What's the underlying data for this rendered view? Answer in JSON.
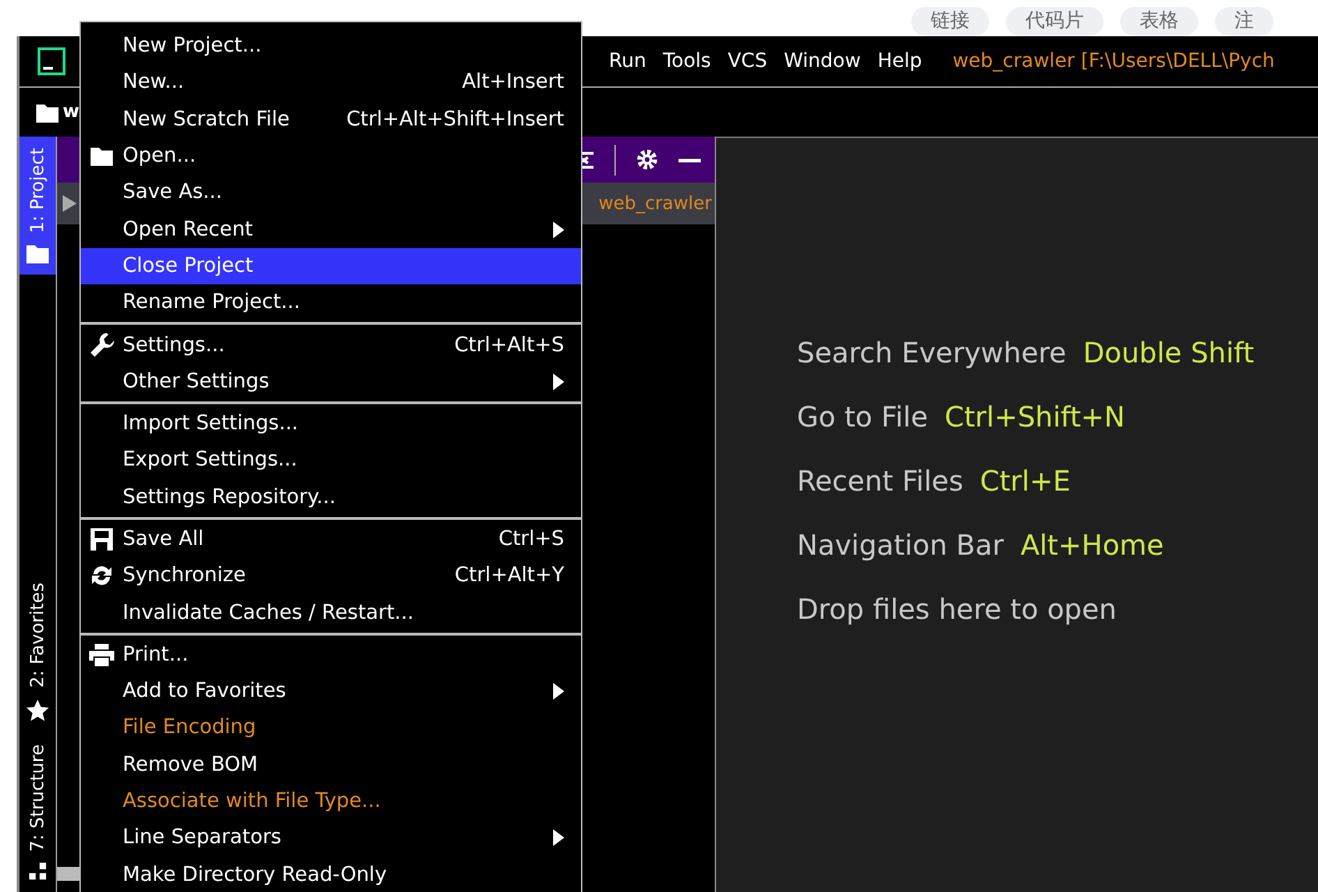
{
  "browser_chips": [
    "链接",
    "代码片",
    "表格",
    "注"
  ],
  "window": {
    "title": "web_crawler [F:\\Users\\DELL\\Pych",
    "menu": [
      "Run",
      "Tools",
      "VCS",
      "Window",
      "Help"
    ]
  },
  "navigation_bar": {
    "path": "w"
  },
  "tool_tabs": [
    {
      "label": "1: Project",
      "kind": "folder",
      "selected": true
    },
    {
      "label": "2: Favorites",
      "kind": "star",
      "selected": false
    },
    {
      "label": "7: Structure",
      "kind": "structure",
      "selected": false
    }
  ],
  "project_panel": {
    "path": "web_crawler"
  },
  "file_menu": [
    [
      {
        "label": "New Project...",
        "selected": false
      },
      {
        "label": "New...",
        "shortcut": "Alt+Insert",
        "selected": false
      },
      {
        "label": "New Scratch File",
        "shortcut": "Ctrl+Alt+Shift+Insert",
        "selected": false
      },
      {
        "label": "Open...",
        "kind": "folder",
        "selected": false
      },
      {
        "label": "Save As...",
        "selected": false
      },
      {
        "label": "Open Recent",
        "submenu": true,
        "selected": false
      },
      {
        "label": "Close Project",
        "selected": true
      },
      {
        "label": "Rename Project...",
        "selected": false
      }
    ],
    [
      {
        "label": "Settings...",
        "kind": "wrench",
        "shortcut": "Ctrl+Alt+S",
        "selected": false
      },
      {
        "label": "Other Settings",
        "submenu": true,
        "selected": false
      }
    ],
    [
      {
        "label": "Import Settings...",
        "selected": false
      },
      {
        "label": "Export Settings...",
        "selected": false
      },
      {
        "label": "Settings Repository...",
        "selected": false
      }
    ],
    [
      {
        "label": "Save All",
        "kind": "save",
        "shortcut": "Ctrl+S",
        "selected": false
      },
      {
        "label": "Synchronize",
        "kind": "sync",
        "shortcut": "Ctrl+Alt+Y",
        "selected": false
      },
      {
        "label": "Invalidate Caches / Restart...",
        "selected": false
      }
    ],
    [
      {
        "label": "Print...",
        "kind": "print",
        "selected": false
      },
      {
        "label": "Add to Favorites",
        "submenu": true,
        "selected": false
      },
      {
        "label": "File Encoding",
        "disabled": true,
        "selected": false
      },
      {
        "label": "Remove BOM",
        "selected": false
      },
      {
        "label": "Associate with File Type...",
        "disabled": true,
        "selected": false
      },
      {
        "label": "Line Separators",
        "submenu": true,
        "selected": false
      },
      {
        "label": "Make Directory Read-Only",
        "selected": false
      }
    ]
  ],
  "editor_hints": [
    {
      "text": "Search Everywhere",
      "shortcut": "Double Shift"
    },
    {
      "text": "Go to File",
      "shortcut": "Ctrl+Shift+N"
    },
    {
      "text": "Recent Files",
      "shortcut": "Ctrl+E"
    },
    {
      "text": "Navigation Bar",
      "shortcut": "Alt+Home"
    },
    {
      "text": "Drop files here to open"
    }
  ]
}
